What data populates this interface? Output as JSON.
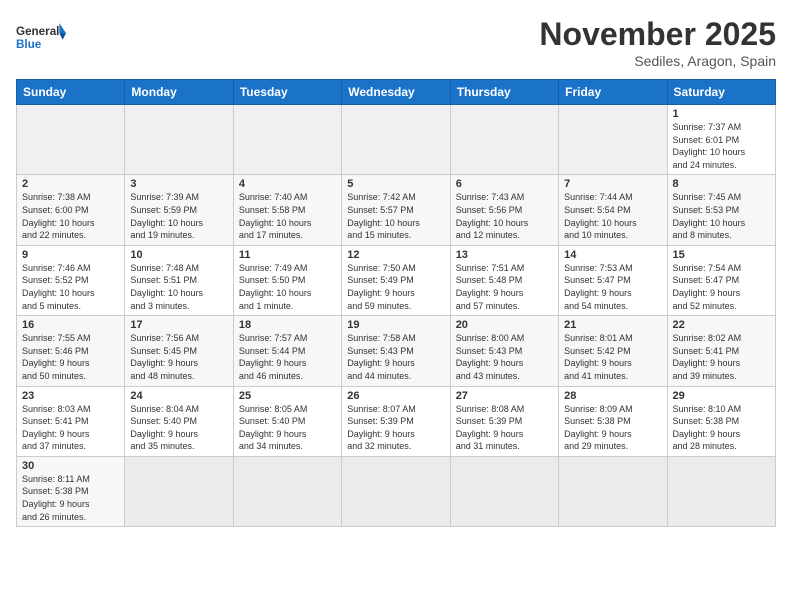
{
  "header": {
    "logo_general": "General",
    "logo_blue": "Blue",
    "month_title": "November 2025",
    "location": "Sediles, Aragon, Spain"
  },
  "weekdays": [
    "Sunday",
    "Monday",
    "Tuesday",
    "Wednesday",
    "Thursday",
    "Friday",
    "Saturday"
  ],
  "weeks": [
    [
      {
        "day": "",
        "info": ""
      },
      {
        "day": "",
        "info": ""
      },
      {
        "day": "",
        "info": ""
      },
      {
        "day": "",
        "info": ""
      },
      {
        "day": "",
        "info": ""
      },
      {
        "day": "",
        "info": ""
      },
      {
        "day": "1",
        "info": "Sunrise: 7:37 AM\nSunset: 6:01 PM\nDaylight: 10 hours\nand 24 minutes."
      }
    ],
    [
      {
        "day": "2",
        "info": "Sunrise: 7:38 AM\nSunset: 6:00 PM\nDaylight: 10 hours\nand 22 minutes."
      },
      {
        "day": "3",
        "info": "Sunrise: 7:39 AM\nSunset: 5:59 PM\nDaylight: 10 hours\nand 19 minutes."
      },
      {
        "day": "4",
        "info": "Sunrise: 7:40 AM\nSunset: 5:58 PM\nDaylight: 10 hours\nand 17 minutes."
      },
      {
        "day": "5",
        "info": "Sunrise: 7:42 AM\nSunset: 5:57 PM\nDaylight: 10 hours\nand 15 minutes."
      },
      {
        "day": "6",
        "info": "Sunrise: 7:43 AM\nSunset: 5:56 PM\nDaylight: 10 hours\nand 12 minutes."
      },
      {
        "day": "7",
        "info": "Sunrise: 7:44 AM\nSunset: 5:54 PM\nDaylight: 10 hours\nand 10 minutes."
      },
      {
        "day": "8",
        "info": "Sunrise: 7:45 AM\nSunset: 5:53 PM\nDaylight: 10 hours\nand 8 minutes."
      }
    ],
    [
      {
        "day": "9",
        "info": "Sunrise: 7:46 AM\nSunset: 5:52 PM\nDaylight: 10 hours\nand 5 minutes."
      },
      {
        "day": "10",
        "info": "Sunrise: 7:48 AM\nSunset: 5:51 PM\nDaylight: 10 hours\nand 3 minutes."
      },
      {
        "day": "11",
        "info": "Sunrise: 7:49 AM\nSunset: 5:50 PM\nDaylight: 10 hours\nand 1 minute."
      },
      {
        "day": "12",
        "info": "Sunrise: 7:50 AM\nSunset: 5:49 PM\nDaylight: 9 hours\nand 59 minutes."
      },
      {
        "day": "13",
        "info": "Sunrise: 7:51 AM\nSunset: 5:48 PM\nDaylight: 9 hours\nand 57 minutes."
      },
      {
        "day": "14",
        "info": "Sunrise: 7:53 AM\nSunset: 5:47 PM\nDaylight: 9 hours\nand 54 minutes."
      },
      {
        "day": "15",
        "info": "Sunrise: 7:54 AM\nSunset: 5:47 PM\nDaylight: 9 hours\nand 52 minutes."
      }
    ],
    [
      {
        "day": "16",
        "info": "Sunrise: 7:55 AM\nSunset: 5:46 PM\nDaylight: 9 hours\nand 50 minutes."
      },
      {
        "day": "17",
        "info": "Sunrise: 7:56 AM\nSunset: 5:45 PM\nDaylight: 9 hours\nand 48 minutes."
      },
      {
        "day": "18",
        "info": "Sunrise: 7:57 AM\nSunset: 5:44 PM\nDaylight: 9 hours\nand 46 minutes."
      },
      {
        "day": "19",
        "info": "Sunrise: 7:58 AM\nSunset: 5:43 PM\nDaylight: 9 hours\nand 44 minutes."
      },
      {
        "day": "20",
        "info": "Sunrise: 8:00 AM\nSunset: 5:43 PM\nDaylight: 9 hours\nand 43 minutes."
      },
      {
        "day": "21",
        "info": "Sunrise: 8:01 AM\nSunset: 5:42 PM\nDaylight: 9 hours\nand 41 minutes."
      },
      {
        "day": "22",
        "info": "Sunrise: 8:02 AM\nSunset: 5:41 PM\nDaylight: 9 hours\nand 39 minutes."
      }
    ],
    [
      {
        "day": "23",
        "info": "Sunrise: 8:03 AM\nSunset: 5:41 PM\nDaylight: 9 hours\nand 37 minutes."
      },
      {
        "day": "24",
        "info": "Sunrise: 8:04 AM\nSunset: 5:40 PM\nDaylight: 9 hours\nand 35 minutes."
      },
      {
        "day": "25",
        "info": "Sunrise: 8:05 AM\nSunset: 5:40 PM\nDaylight: 9 hours\nand 34 minutes."
      },
      {
        "day": "26",
        "info": "Sunrise: 8:07 AM\nSunset: 5:39 PM\nDaylight: 9 hours\nand 32 minutes."
      },
      {
        "day": "27",
        "info": "Sunrise: 8:08 AM\nSunset: 5:39 PM\nDaylight: 9 hours\nand 31 minutes."
      },
      {
        "day": "28",
        "info": "Sunrise: 8:09 AM\nSunset: 5:38 PM\nDaylight: 9 hours\nand 29 minutes."
      },
      {
        "day": "29",
        "info": "Sunrise: 8:10 AM\nSunset: 5:38 PM\nDaylight: 9 hours\nand 28 minutes."
      }
    ],
    [
      {
        "day": "30",
        "info": "Sunrise: 8:11 AM\nSunset: 5:38 PM\nDaylight: 9 hours\nand 26 minutes."
      },
      {
        "day": "",
        "info": ""
      },
      {
        "day": "",
        "info": ""
      },
      {
        "day": "",
        "info": ""
      },
      {
        "day": "",
        "info": ""
      },
      {
        "day": "",
        "info": ""
      },
      {
        "day": "",
        "info": ""
      }
    ]
  ]
}
